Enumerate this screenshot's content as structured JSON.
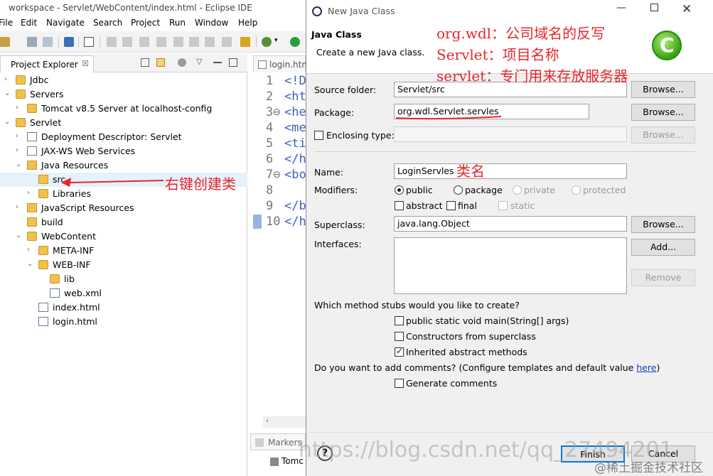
{
  "window": {
    "title": "workspace - Servlet/WebContent/index.html - Eclipse IDE"
  },
  "menu": [
    "File",
    "Edit",
    "Navigate",
    "Search",
    "Project",
    "Run",
    "Window",
    "Help"
  ],
  "explorer": {
    "tab_label": "Project Explorer",
    "tab_close": "☒",
    "tree": [
      {
        "label": "Jdbc",
        "depth": 0,
        "expanded": false,
        "icon": "project-icon"
      },
      {
        "label": "Servers",
        "depth": 0,
        "expanded": true,
        "icon": "folder-icon"
      },
      {
        "label": "Tomcat v8.5 Server at localhost-config",
        "depth": 1,
        "expanded": false,
        "icon": "folder-icon"
      },
      {
        "label": "Servlet",
        "depth": 0,
        "expanded": true,
        "icon": "project-icon"
      },
      {
        "label": "Deployment Descriptor: Servlet",
        "depth": 1,
        "expanded": false,
        "icon": "descriptor-icon"
      },
      {
        "label": "JAX-WS Web Services",
        "depth": 1,
        "expanded": false,
        "icon": "webservice-icon"
      },
      {
        "label": "Java Resources",
        "depth": 1,
        "expanded": true,
        "icon": "java-resources-icon"
      },
      {
        "label": "src",
        "depth": 2,
        "expanded": null,
        "icon": "source-folder-icon",
        "selected": true
      },
      {
        "label": "Libraries",
        "depth": 2,
        "expanded": false,
        "icon": "library-icon"
      },
      {
        "label": "JavaScript Resources",
        "depth": 1,
        "expanded": false,
        "icon": "js-resources-icon"
      },
      {
        "label": "build",
        "depth": 1,
        "expanded": null,
        "icon": "folder-icon"
      },
      {
        "label": "WebContent",
        "depth": 1,
        "expanded": true,
        "icon": "folder-icon"
      },
      {
        "label": "META-INF",
        "depth": 2,
        "expanded": false,
        "icon": "folder-icon"
      },
      {
        "label": "WEB-INF",
        "depth": 2,
        "expanded": true,
        "icon": "folder-icon"
      },
      {
        "label": "lib",
        "depth": 3,
        "expanded": null,
        "icon": "folder-icon"
      },
      {
        "label": "web.xml",
        "depth": 3,
        "expanded": null,
        "icon": "xml-file-icon"
      },
      {
        "label": "index.html",
        "depth": 2,
        "expanded": null,
        "icon": "html-file-icon"
      },
      {
        "label": "login.html",
        "depth": 2,
        "expanded": null,
        "icon": "html-file-icon"
      }
    ]
  },
  "editor": {
    "tab_label": "login.htm",
    "lines": [
      {
        "num": "1",
        "code": "<!D"
      },
      {
        "num": "2",
        "code": "<ht"
      },
      {
        "num": "3⊖",
        "code": "<he"
      },
      {
        "num": "4",
        "code": "<me"
      },
      {
        "num": "5",
        "code": "<ti"
      },
      {
        "num": "6",
        "code": "</h"
      },
      {
        "num": "7⊖",
        "code": "<bo"
      },
      {
        "num": "8",
        "code": ""
      },
      {
        "num": "9",
        "code": "</b"
      },
      {
        "num": "10",
        "code": "</h"
      }
    ]
  },
  "markers": {
    "tab_label": "Markers",
    "row_label": "Tomc"
  },
  "dialog": {
    "title": "New Java Class",
    "header_title": "Java Class",
    "header_subtitle": "Create a new Java class.",
    "source_folder_label": "Source folder:",
    "source_folder_value": "Servlet/src",
    "package_label": "Package:",
    "package_value": "org.wdl.Servlet.servles",
    "enclosing_label": "Enclosing type:",
    "name_label": "Name:",
    "name_value": "LoginServles",
    "modifiers_label": "Modifiers:",
    "mod_public": "public",
    "mod_package": "package",
    "mod_private": "private",
    "mod_protected": "protected",
    "mod_abstract": "abstract",
    "mod_final": "final",
    "mod_static": "static",
    "superclass_label": "Superclass:",
    "superclass_value": "java.lang.Object",
    "interfaces_label": "Interfaces:",
    "browse": "Browse...",
    "add": "Add...",
    "remove": "Remove",
    "stubs_question": "Which method stubs would you like to create?",
    "stub_main": "public static void main(String[] args)",
    "stub_constructors": "Constructors from superclass",
    "stub_inherited": "Inherited abstract methods",
    "comments_question": "Do you want to add comments? (Configure templates and default value ",
    "comments_link": "here",
    "comments_close": ")",
    "generate_comments": "Generate comments",
    "help": "?",
    "finish": "Finish",
    "cancel": "Cancel"
  },
  "annotations": {
    "line1": "org.wdl：公司域名的反写",
    "line2": "Servlet：项目名称",
    "line3": "servlet：专门用来存放服务器",
    "class_name": "类名",
    "right_click": "右键创建类"
  },
  "watermarks": {
    "url": "https://blog.csdn.net/qq_27494201",
    "community": "@稀土掘金技术社区"
  },
  "colors": {
    "annotation": "#e8262b",
    "selection": "#e5f1fb"
  }
}
